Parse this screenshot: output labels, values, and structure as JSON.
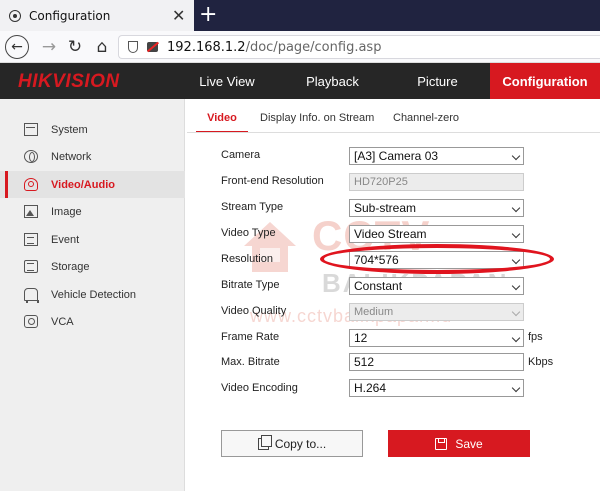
{
  "browser": {
    "tab_title": "Configuration",
    "tab_close": "✕",
    "new_tab": "+",
    "url_host": "192.168.1.2",
    "url_path": "/doc/page/config.asp"
  },
  "header": {
    "logo": "HIKVISION",
    "menu": {
      "live_view": "Live View",
      "playback": "Playback",
      "picture": "Picture",
      "configuration": "Configuration"
    }
  },
  "sidebar": {
    "items": [
      {
        "label": "System",
        "icon": "system-icon"
      },
      {
        "label": "Network",
        "icon": "globe-icon"
      },
      {
        "label": "Video/Audio",
        "icon": "camera-icon"
      },
      {
        "label": "Image",
        "icon": "image-icon"
      },
      {
        "label": "Event",
        "icon": "event-icon"
      },
      {
        "label": "Storage",
        "icon": "storage-icon"
      },
      {
        "label": "Vehicle Detection",
        "icon": "vehicle-icon"
      },
      {
        "label": "VCA",
        "icon": "vca-icon"
      }
    ],
    "active": "Video/Audio"
  },
  "subtabs": {
    "video": "Video",
    "display_info": "Display Info. on Stream",
    "channel_zero": "Channel-zero"
  },
  "form": {
    "camera": {
      "label": "Camera",
      "value": "[A3] Camera 03"
    },
    "front_end_resolution": {
      "label": "Front-end Resolution",
      "value": "HD720P25"
    },
    "stream_type": {
      "label": "Stream Type",
      "value": "Sub-stream"
    },
    "video_type": {
      "label": "Video Type",
      "value": "Video Stream"
    },
    "resolution": {
      "label": "Resolution",
      "value": "704*576"
    },
    "bitrate_type": {
      "label": "Bitrate Type",
      "value": "Constant"
    },
    "video_quality": {
      "label": "Video Quality",
      "value": "Medium"
    },
    "frame_rate": {
      "label": "Frame Rate",
      "value": "12",
      "unit": "fps"
    },
    "max_bitrate": {
      "label": "Max. Bitrate",
      "value": "512",
      "unit": "Kbps"
    },
    "video_encoding": {
      "label": "Video Encoding",
      "value": "H.264"
    }
  },
  "watermark": {
    "line1": "CCTV",
    "line2": "BALIKPAPAN",
    "line3": "www.cctvbalikpapan.id"
  },
  "buttons": {
    "copy": "Copy to...",
    "save": "Save"
  },
  "colors": {
    "brand_red": "#d71920",
    "header_bg": "#262626",
    "highlight": "#e0141e"
  }
}
